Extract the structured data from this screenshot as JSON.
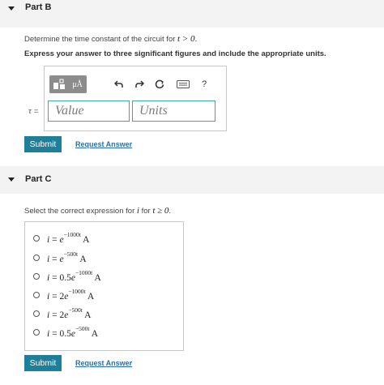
{
  "part_b": {
    "title": "Part B",
    "question_prefix": "Determine the time constant of the circuit for ",
    "question_math": "t > 0",
    "question_suffix": ".",
    "instructions": "Express your answer to three significant figures and include the appropriate units.",
    "toolbar": {
      "units_button": "μÅ",
      "help_button": "?"
    },
    "answer_label_symbol": "τ",
    "answer_label_eq": "=",
    "value_placeholder": "Value",
    "units_placeholder": "Units",
    "submit_label": "Submit",
    "request_label": "Request Answer"
  },
  "part_c": {
    "title": "Part C",
    "question_prefix": "Select the correct expression for ",
    "question_var": "i",
    "question_mid": " for ",
    "question_math": "t ≥ 0",
    "question_suffix": ".",
    "options": [
      {
        "lhs": "i",
        "eq": " = ",
        "coef": "",
        "base": "e",
        "exp": "−1000t",
        "unit": "A"
      },
      {
        "lhs": "i",
        "eq": " = ",
        "coef": "",
        "base": "e",
        "exp": "−500t",
        "unit": "A"
      },
      {
        "lhs": "i",
        "eq": " = ",
        "coef": "0.5",
        "base": "e",
        "exp": "−1000t",
        "unit": "A"
      },
      {
        "lhs": "i",
        "eq": " = ",
        "coef": "2",
        "base": "e",
        "exp": "−1000t",
        "unit": "A"
      },
      {
        "lhs": "i",
        "eq": " = ",
        "coef": "2",
        "base": "e",
        "exp": "−500t",
        "unit": "A"
      },
      {
        "lhs": "i",
        "eq": " = ",
        "coef": "0.5",
        "base": "e",
        "exp": "−500t",
        "unit": "A"
      }
    ],
    "submit_label": "Submit",
    "request_label": "Request Answer"
  }
}
